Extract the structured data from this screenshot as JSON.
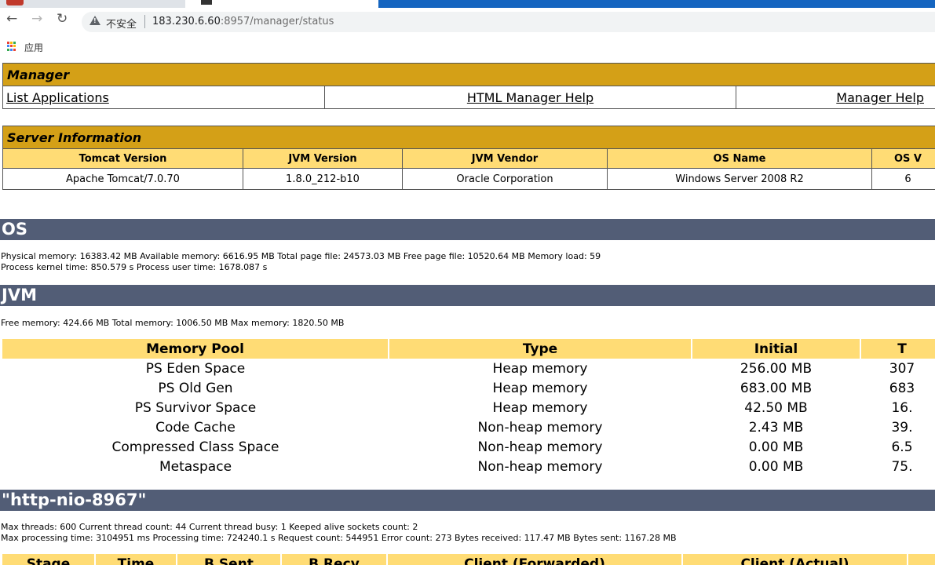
{
  "browser": {
    "insecure_label": "不安全",
    "url_host": "183.230.6.60",
    "url_rest": ":8957/manager/status",
    "bookmark_apps_label": "应用"
  },
  "manager": {
    "title": "Manager",
    "links": [
      "List Applications",
      "HTML Manager Help",
      "Manager Help"
    ]
  },
  "server_info": {
    "title": "Server Information",
    "headers": [
      "Tomcat Version",
      "JVM Version",
      "JVM Vendor",
      "OS Name",
      "OS V"
    ],
    "values": [
      "Apache Tomcat/7.0.70",
      "1.8.0_212-b10",
      "Oracle Corporation",
      "Windows Server 2008 R2",
      "6"
    ]
  },
  "os": {
    "title": "OS",
    "line1": "Physical memory: 16383.42 MB Available memory: 6616.95 MB Total page file: 24573.03 MB Free page file: 10520.64 MB Memory load: 59",
    "line2": "Process kernel time: 850.579 s Process user time: 1678.087 s"
  },
  "jvm": {
    "title": "JVM",
    "line1": "Free memory: 424.66 MB Total memory: 1006.50 MB Max memory: 1820.50 MB"
  },
  "memory_pools": {
    "headers": [
      "Memory Pool",
      "Type",
      "Initial",
      "T"
    ],
    "rows": [
      [
        "PS Eden Space",
        "Heap memory",
        "256.00 MB",
        "307"
      ],
      [
        "PS Old Gen",
        "Heap memory",
        "683.00 MB",
        "683"
      ],
      [
        "PS Survivor Space",
        "Heap memory",
        "42.50 MB",
        "16."
      ],
      [
        "Code Cache",
        "Non-heap memory",
        "2.43 MB",
        "39."
      ],
      [
        "Compressed Class Space",
        "Non-heap memory",
        "0.00 MB",
        "6.5"
      ],
      [
        "Metaspace",
        "Non-heap memory",
        "0.00 MB",
        "75."
      ]
    ]
  },
  "connector": {
    "title": "\"http-nio-8967\"",
    "line1": "Max threads: 600 Current thread count: 44 Current thread busy: 1 Keeped alive sockets count: 2",
    "line2": "Max processing time: 3104951 ms Processing time: 724240.1 s Request count: 544951 Error count: 273 Bytes received: 117.47 MB Bytes sent: 1167.28 MB",
    "stage_headers": [
      "Stage",
      "Time",
      "B Sent",
      "B Recv",
      "Client (Forwarded)",
      "Client (Actual)",
      ""
    ]
  },
  "colors": {
    "title_bg": "#d4a017",
    "header_bg": "#ffdc75",
    "section_bar": "#525d76"
  }
}
